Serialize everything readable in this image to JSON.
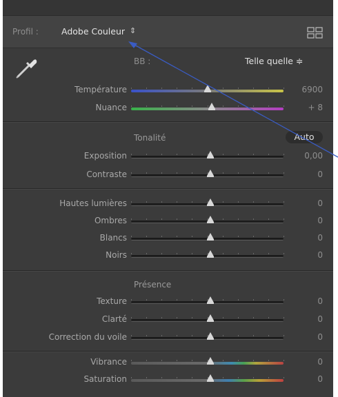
{
  "profile": {
    "label": "Profil :",
    "value": "Adobe Couleur",
    "arrows": "⇕"
  },
  "wb": {
    "label": "BB :",
    "value": "Telle quelle ≑"
  },
  "basic_sliders": [
    {
      "label": "Température",
      "value": "6900",
      "position": 0.5,
      "track": "temp"
    },
    {
      "label": "Nuance",
      "value": "+ 8",
      "position": 0.53,
      "track": "tint"
    }
  ],
  "tone": {
    "title": "Tonalité",
    "auto_label": "Auto",
    "sliders": [
      {
        "label": "Exposition",
        "value": "0,00",
        "position": 0.52,
        "track": "gray"
      },
      {
        "label": "Contraste",
        "value": "0",
        "position": 0.52,
        "track": "gray"
      }
    ]
  },
  "light": {
    "sliders": [
      {
        "label": "Hautes lumières",
        "value": "0",
        "position": 0.52,
        "track": "gray"
      },
      {
        "label": "Ombres",
        "value": "0",
        "position": 0.52,
        "track": "gray"
      },
      {
        "label": "Blancs",
        "value": "0",
        "position": 0.52,
        "track": "gray"
      },
      {
        "label": "Noirs",
        "value": "0",
        "position": 0.52,
        "track": "gray"
      }
    ]
  },
  "presence": {
    "title": "Présence",
    "sliders": [
      {
        "label": "Texture",
        "value": "0",
        "position": 0.52,
        "track": "gray"
      },
      {
        "label": "Clarté",
        "value": "0",
        "position": 0.52,
        "track": "gray"
      },
      {
        "label": "Correction du voile",
        "value": "0",
        "position": 0.52,
        "track": "gray"
      }
    ]
  },
  "color": {
    "sliders": [
      {
        "label": "Vibrance",
        "value": "0",
        "position": 0.52,
        "track": "vib"
      },
      {
        "label": "Saturation",
        "value": "0",
        "position": 0.52,
        "track": "sat"
      }
    ]
  },
  "icons": {
    "eyedropper": "eyedropper-icon",
    "grid": "grid-view-icon"
  },
  "colors": {
    "panel": "#3b3b3b",
    "annotation_arrow": "#3a5cc4"
  }
}
